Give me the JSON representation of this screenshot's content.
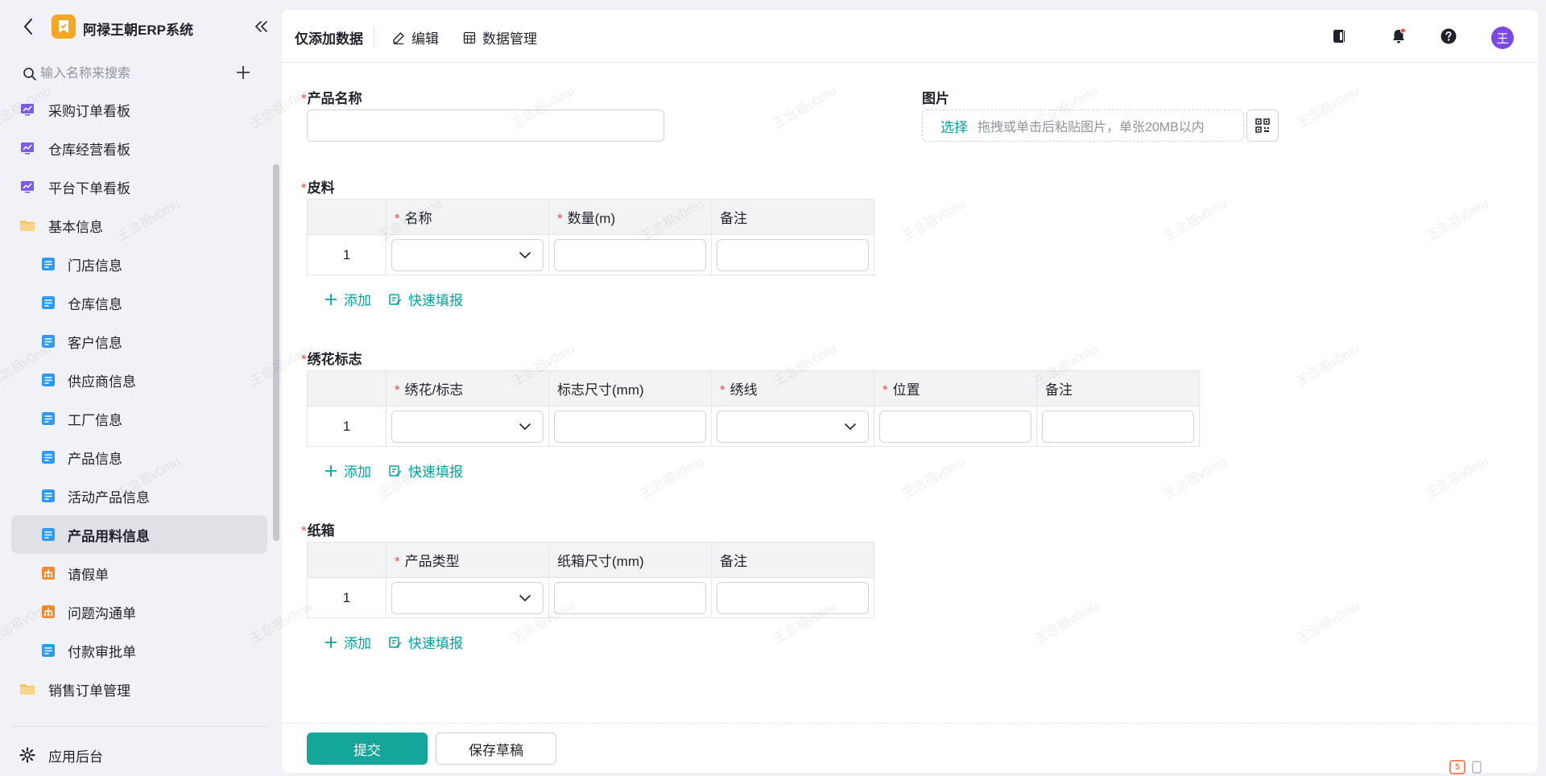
{
  "sidebar": {
    "app_title": "阿禄王朝ERP系统",
    "search_placeholder": "输入名称来搜索",
    "items": [
      {
        "label": "采购订单看板",
        "icon": "dashboard-icon",
        "level": 0
      },
      {
        "label": "仓库经营看板",
        "icon": "dashboard-icon",
        "level": 0
      },
      {
        "label": "平台下单看板",
        "icon": "dashboard-icon",
        "level": 0
      },
      {
        "label": "基本信息",
        "icon": "folder-icon",
        "level": 0
      },
      {
        "label": "门店信息",
        "icon": "form-icon",
        "level": 1
      },
      {
        "label": "仓库信息",
        "icon": "form-icon",
        "level": 1
      },
      {
        "label": "客户信息",
        "icon": "form-icon",
        "level": 1
      },
      {
        "label": "供应商信息",
        "icon": "form-icon",
        "level": 1
      },
      {
        "label": "工厂信息",
        "icon": "form-icon",
        "level": 1
      },
      {
        "label": "产品信息",
        "icon": "form-icon",
        "level": 1
      },
      {
        "label": "活动产品信息",
        "icon": "form-icon",
        "level": 1
      },
      {
        "label": "产品用料信息",
        "icon": "form-icon",
        "level": 1,
        "active": true
      },
      {
        "label": "请假单",
        "icon": "workflow-icon",
        "level": 1
      },
      {
        "label": "问题沟通单",
        "icon": "workflow-icon",
        "level": 1
      },
      {
        "label": "付款审批单",
        "icon": "form-icon",
        "level": 1
      },
      {
        "label": "销售订单管理",
        "icon": "folder-icon",
        "level": 0
      }
    ],
    "bottom_label": "应用后台"
  },
  "topbar": {
    "title": "仅添加数据",
    "edit_label": "编辑",
    "data_manage_label": "数据管理",
    "avatar_text": "王"
  },
  "form": {
    "product_name_label": "产品名称",
    "image_label": "图片",
    "upload_select": "选择",
    "upload_hint": "拖拽或单击后粘贴图片，单张20MB以内",
    "leather": {
      "label": "皮料",
      "columns": [
        {
          "label": "名称",
          "required": true
        },
        {
          "label": "数量(m)",
          "required": true
        },
        {
          "label": "备注",
          "required": false
        }
      ],
      "rows": [
        [
          "1"
        ]
      ]
    },
    "embroidery": {
      "label": "绣花标志",
      "columns": [
        {
          "label": "绣花/标志",
          "required": true
        },
        {
          "label": "标志尺寸(mm)",
          "required": false
        },
        {
          "label": "绣线",
          "required": true
        },
        {
          "label": "位置",
          "required": true
        },
        {
          "label": "备注",
          "required": false
        }
      ],
      "rows": [
        [
          "1"
        ]
      ]
    },
    "carton": {
      "label": "纸箱",
      "columns": [
        {
          "label": "产品类型",
          "required": true
        },
        {
          "label": "纸箱尺寸(mm)",
          "required": false
        },
        {
          "label": "备注",
          "required": false
        }
      ],
      "rows": [
        [
          "1"
        ]
      ]
    },
    "add_label": "添加",
    "quick_fill_label": "快速填报"
  },
  "footer": {
    "submit_label": "提交",
    "draft_label": "保存草稿"
  },
  "watermark_text": "王念祖v0mu",
  "colors": {
    "accent": "#14a69a",
    "link": "#00a3a3",
    "required": "#f54a45",
    "avatar": "#7b4ae2",
    "logo": "#f5a623"
  }
}
